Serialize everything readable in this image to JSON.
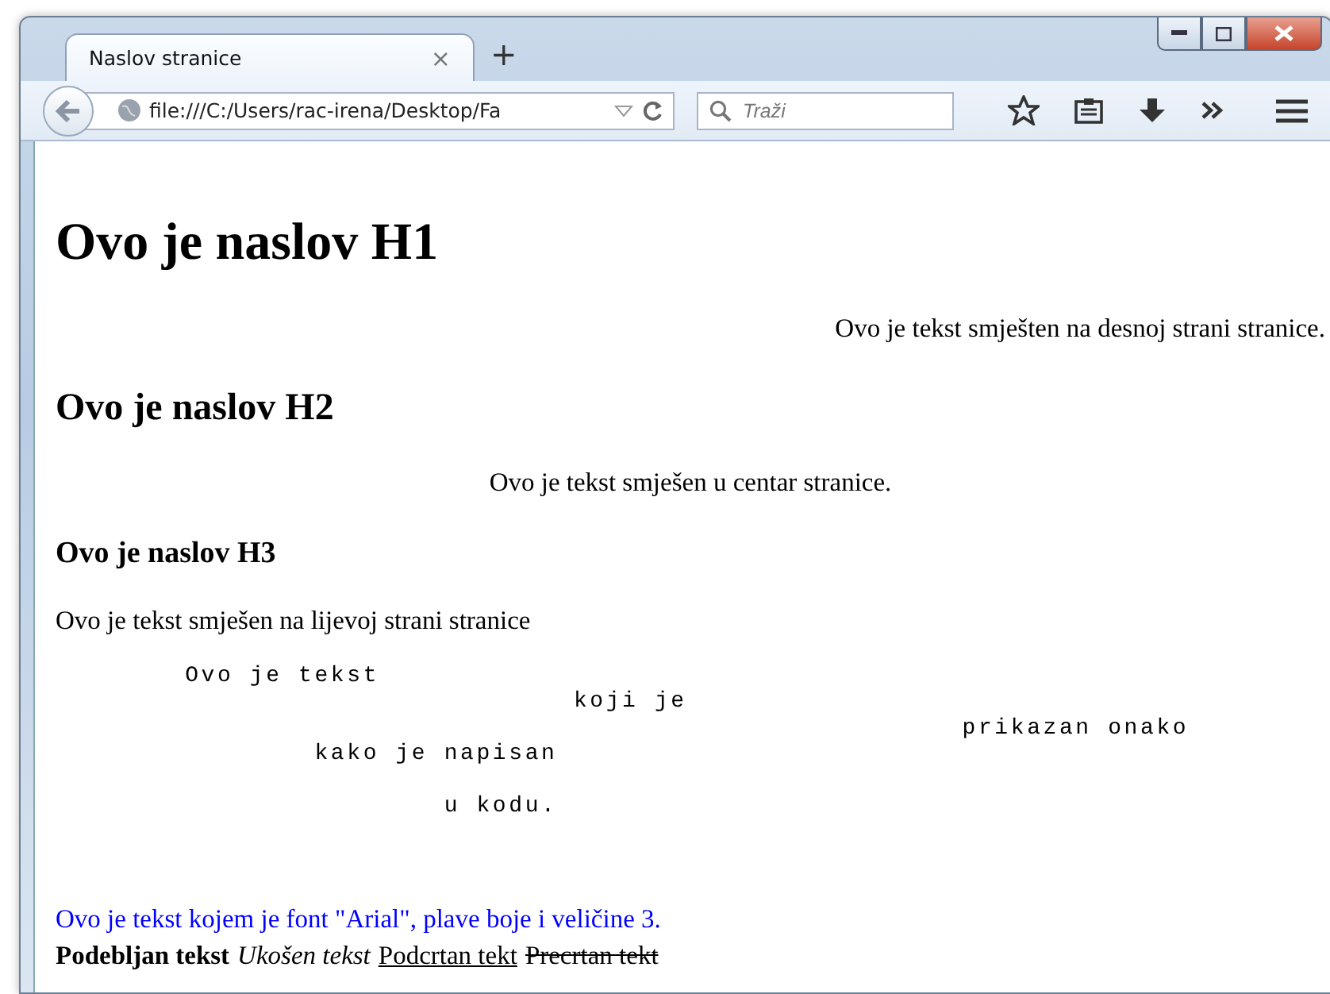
{
  "tab": {
    "title": "Naslov stranice",
    "selected": true,
    "close": "×"
  },
  "new_tab": "+",
  "url": "file:///C:/Users/rac-irena/Desktop/Fa",
  "search": {
    "placeholder": "Traži"
  },
  "page": {
    "h1": "Ovo je naslov H1",
    "right_text": "Ovo je tekst smješten na desnoj strani stranice.",
    "h2": "Ovo je naslov H2",
    "center_text": "Ovo je tekst smješen u centar stranice.",
    "h3": "Ovo je naslov H3",
    "left_text": "Ovo je tekst smješen na lijevoj strani stranice",
    "pre": "        Ovo je tekst\n                                koji je\n                                                        prikazan onako\n                kako je napisan\n\n                        u kodu.",
    "blue_text": "Ovo je tekst kojem je font \"Arial\", plave boje i veličine 3.",
    "styles": [
      {
        "kind": "bold",
        "text": "Podebljan tekst"
      },
      {
        "kind": "italic",
        "text": "Ukošen tekst"
      },
      {
        "kind": "underline",
        "text": "Podcrtan tekt"
      },
      {
        "kind": "strike",
        "text": "Precrtan tekt"
      }
    ]
  }
}
